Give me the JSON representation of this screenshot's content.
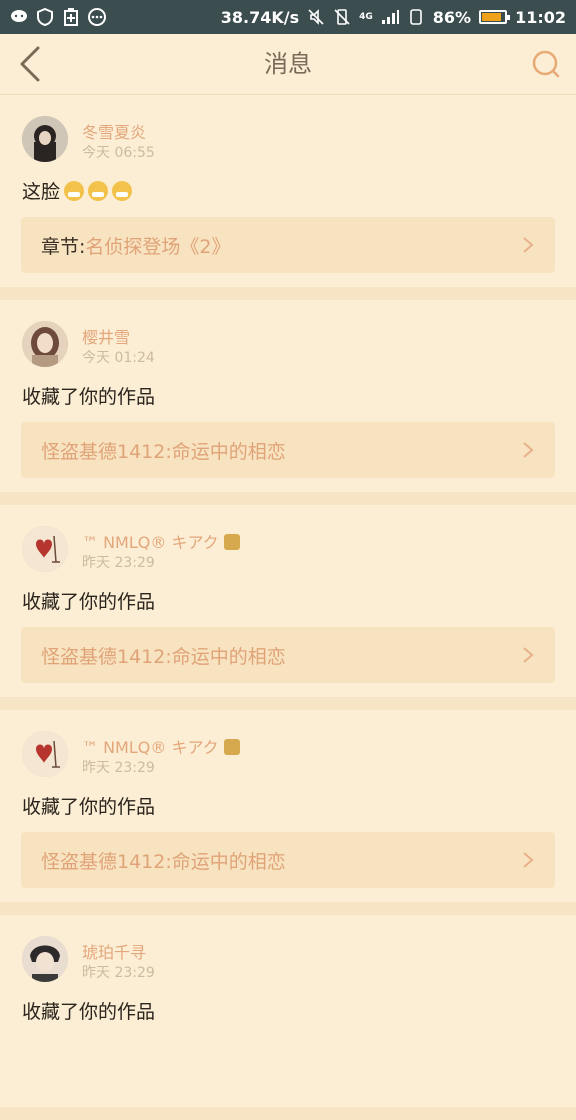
{
  "status": {
    "speed": "38.74K/s",
    "battery": "86%",
    "battery_fill": 0.86,
    "time": "11:02",
    "net": "4G"
  },
  "nav": {
    "title": "消息"
  },
  "messages": [
    {
      "name": "冬雪夏炎",
      "time": "今天 06:55",
      "text": "这脸",
      "emoji_count": 3,
      "link_label": "章节:",
      "link_text": "名侦探登场《2》"
    },
    {
      "name": "樱井雪",
      "time": "今天 01:24",
      "text": "收藏了你的作品",
      "link_label": "",
      "link_text": "怪盗基德1412:命运中的相恋"
    },
    {
      "name": "™ NMLQ® キアク",
      "time": "昨天 23:29",
      "text": "收藏了你的作品",
      "link_label": "",
      "link_text": "怪盗基德1412:命运中的相恋"
    },
    {
      "name": "™ NMLQ® キアク",
      "time": "昨天 23:29",
      "text": "收藏了你的作品",
      "link_label": "",
      "link_text": "怪盗基德1412:命运中的相恋"
    },
    {
      "name": "琥珀千寻",
      "time": "昨天 23:29",
      "text": "收藏了你的作品"
    }
  ],
  "colors": {
    "accent": "#e3a77b",
    "background": "#fbeed5",
    "statusbar": "#3b4d4f"
  }
}
